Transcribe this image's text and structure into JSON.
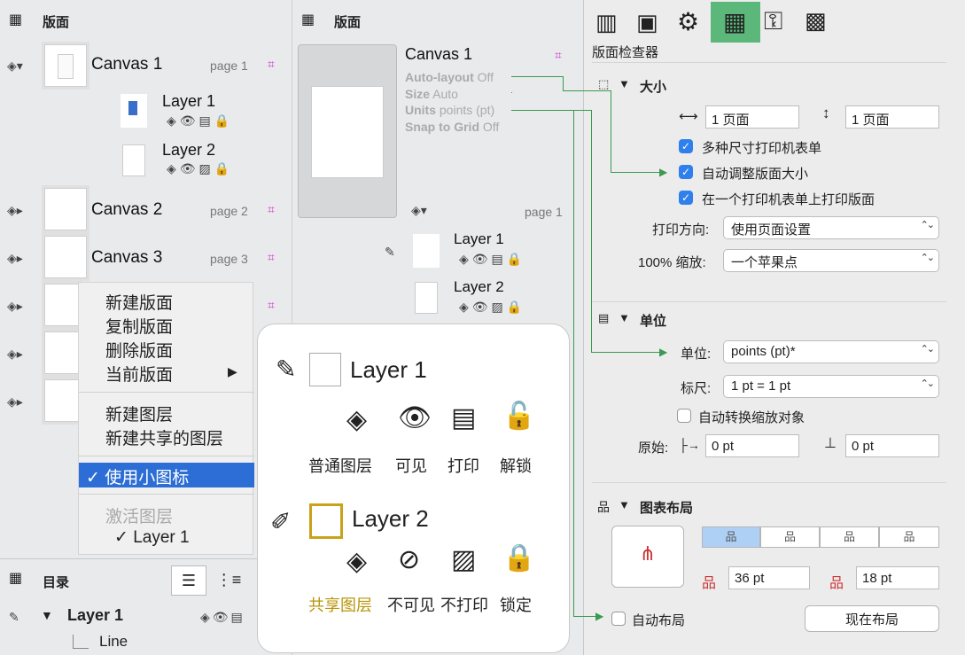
{
  "left_panel": {
    "header": "版面",
    "canvases": [
      {
        "name": "Canvas 1",
        "page": "page 1"
      },
      {
        "name": "Canvas 2",
        "page": "page 2"
      },
      {
        "name": "Canvas 3",
        "page": "page 3"
      }
    ],
    "layers": [
      {
        "name": "Layer 1"
      },
      {
        "name": "Layer 2"
      }
    ],
    "outline_header": "目录",
    "outline_layer": "Layer 1",
    "outline_line": "Line"
  },
  "context_menu": {
    "items": [
      "新建版面",
      "复制版面",
      "删除版面",
      "当前版面"
    ],
    "items2": [
      "新建图层",
      "新建共享的图层"
    ],
    "selected": "✓ 使用小图标",
    "disabled": "激活图层",
    "sub": "✓ Layer 1"
  },
  "mid_panel": {
    "header": "版面",
    "canvas_name": "Canvas 1",
    "props": [
      {
        "key": "Auto-layout",
        "val": "Off"
      },
      {
        "key": "Size",
        "val": "Auto"
      },
      {
        "key": "Units",
        "val": "points (pt)"
      },
      {
        "key": "Snap to Grid",
        "val": "Off"
      }
    ],
    "page": "page 1",
    "layers": [
      {
        "name": "Layer 1"
      },
      {
        "name": "Layer 2"
      }
    ]
  },
  "legend": {
    "layer1": "Layer 1",
    "layer2": "Layer 2",
    "row1_labels": [
      "普通图层",
      "可见",
      "打印",
      "解锁"
    ],
    "row2_labels": [
      "共享图层",
      "不可见",
      "不打印",
      "锁定"
    ],
    "shared_color": "#b8950a"
  },
  "inspector": {
    "title": "版面检查器",
    "size_section": "大小",
    "width": "1 页面",
    "height": "1 页面",
    "checks": [
      "多种尺寸打印机表单",
      "自动调整版面大小",
      "在一个打印机表单上打印版面"
    ],
    "orientation_label": "打印方向:",
    "orientation_value": "使用页面设置",
    "scale_label": "100% 缩放:",
    "scale_value": "一个苹果点",
    "units_section": "单位",
    "units_label": "单位:",
    "units_value": "points (pt)*",
    "ruler_label": "标尺:",
    "ruler_value": "1 pt = 1 pt",
    "auto_scale": "自动转换缩放对象",
    "origin_label": "原始:",
    "origin_x": "0 pt",
    "origin_y": "0 pt",
    "layout_section": "图表布局",
    "spacing_a": "36 pt",
    "spacing_b": "18 pt",
    "auto_layout": "自动布局",
    "layout_now": "现在布局",
    "accent": "#2f80ed",
    "active_tab_color": "#5cb87a"
  }
}
